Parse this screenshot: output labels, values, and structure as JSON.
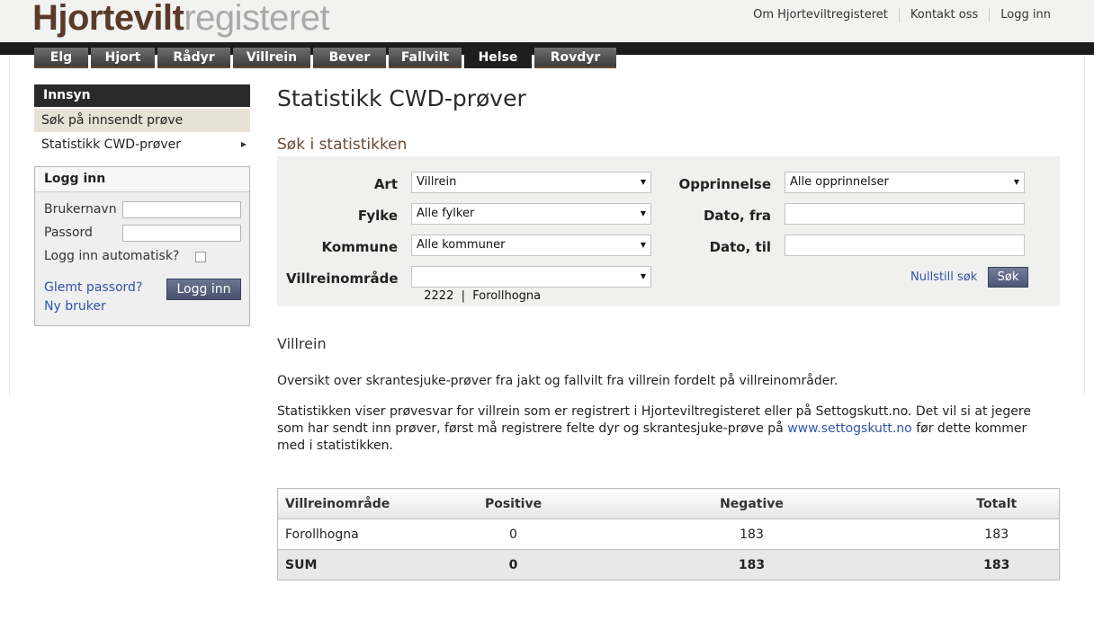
{
  "brand": {
    "part1": "Hjortevilt",
    "part2": "registeret"
  },
  "toplinks": [
    "Om Hjorteviltregisteret",
    "Kontakt oss",
    "Logg inn"
  ],
  "nav": [
    "Elg",
    "Hjort",
    "Rådyr",
    "Villrein",
    "Bever",
    "Fallvilt",
    "Helse",
    "Rovdyr"
  ],
  "nav_active": "Helse",
  "sidebar": {
    "title": "Innsyn",
    "items": [
      "Søk på innsendt prøve",
      "Statistikk CWD-prøver"
    ]
  },
  "login": {
    "title": "Logg inn",
    "username_label": "Brukernavn",
    "password_label": "Passord",
    "auto_label": "Logg inn automatisk?",
    "forgot": "Glemt passord?",
    "new_user": "Ny bruker",
    "button": "Logg inn"
  },
  "page": {
    "title": "Statistikk CWD-prøver",
    "search_title": "Søk i statistikken"
  },
  "search": {
    "art_label": "Art",
    "art_value": "Villrein",
    "fylke_label": "Fylke",
    "fylke_value": "Alle fylker",
    "kommune_label": "Kommune",
    "kommune_value": "Alle kommuner",
    "omrade_label": "Villreinområde",
    "omrade_value": "2222  |  Forollhogna",
    "opprinnelse_label": "Opprinnelse",
    "opprinnelse_value": "Alle opprinnelser",
    "dato_fra_label": "Dato, fra",
    "dato_til_label": "Dato, til",
    "reset_label": "Nullstill søk",
    "search_button": "Søk"
  },
  "section": {
    "title": "Villrein",
    "para1": "Oversikt over skrantesjuke-prøver fra jakt og fallvilt fra villrein fordelt på villreinområder.",
    "para2a": "Statistikken viser prøvesvar for villrein som er registrert i Hjorteviltregisteret eller på Settogskutt.no. Det vil si at jegere som har sendt inn prøver, først må registrere felte dyr og skrantesjuke-prøve på",
    "para2_link": "www.settogskutt.no",
    "para2b": "før dette kommer med i statistikken."
  },
  "table": {
    "headers": [
      "Villreinområde",
      "Positive",
      "Negative",
      "Totalt"
    ],
    "rows": [
      [
        "Forollhogna",
        "0",
        "183",
        "183"
      ]
    ],
    "sum": [
      "SUM",
      "0",
      "183",
      "183"
    ]
  },
  "colors": {
    "brand_brown": "#5a3a2a",
    "link": "#2f55a8",
    "button": "#485170"
  }
}
